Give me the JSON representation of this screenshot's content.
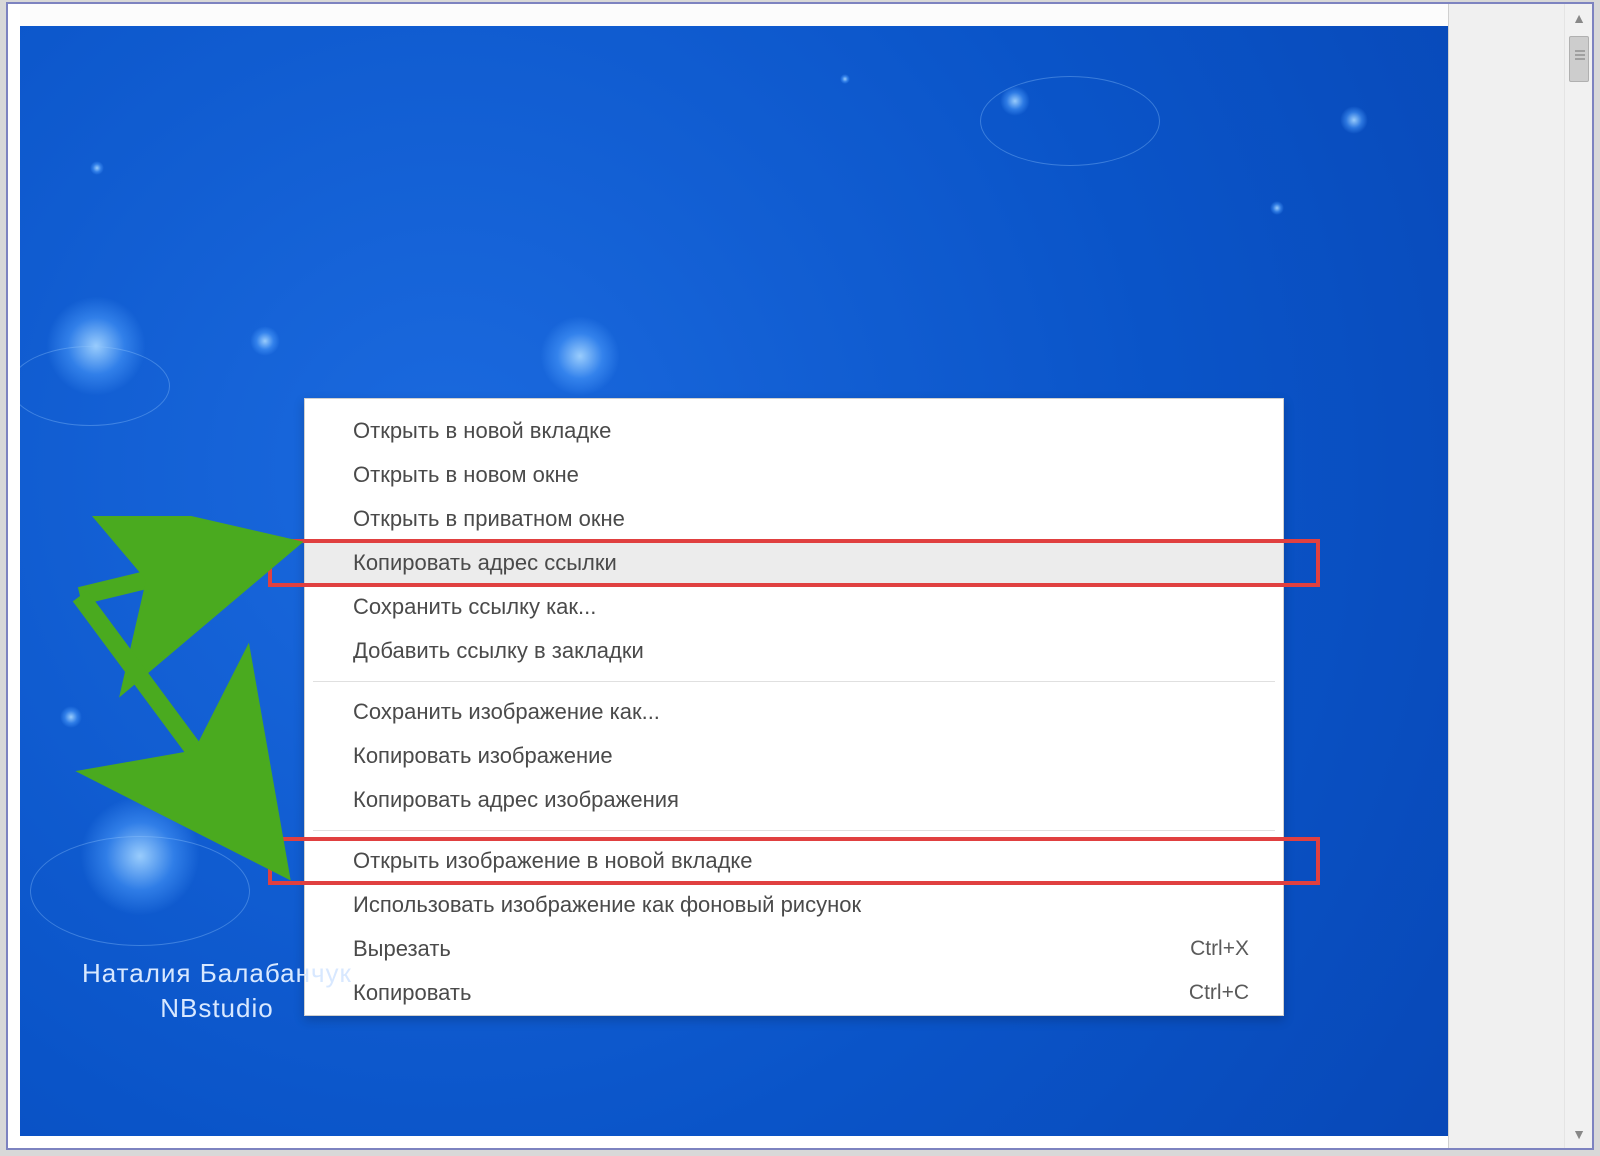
{
  "context_menu": {
    "items": [
      {
        "label": "Открыть в новой вкладке",
        "shortcut": "",
        "hover": false
      },
      {
        "label": "Открыть в новом окне",
        "shortcut": "",
        "hover": false
      },
      {
        "label": "Открыть в приватном окне",
        "shortcut": "",
        "hover": false
      },
      {
        "label": "Копировать адрес ссылки",
        "shortcut": "",
        "hover": true
      },
      {
        "label": "Сохранить ссылку как...",
        "shortcut": "",
        "hover": false
      },
      {
        "label": "Добавить ссылку в закладки",
        "shortcut": "",
        "hover": false
      },
      {
        "sep": true
      },
      {
        "label": "Сохранить изображение как...",
        "shortcut": "",
        "hover": false
      },
      {
        "label": "Копировать изображение",
        "shortcut": "",
        "hover": false
      },
      {
        "label": "Копировать адрес изображения",
        "shortcut": "",
        "hover": false
      },
      {
        "sep": true
      },
      {
        "label": "Открыть изображение в новой вкладке",
        "shortcut": "",
        "hover": false
      },
      {
        "label": "Использовать изображение как фоновый рисунок",
        "shortcut": "",
        "hover": false
      },
      {
        "label": "Вырезать",
        "shortcut": "Ctrl+X",
        "hover": false
      },
      {
        "label": "Копировать",
        "shortcut": "Ctrl+C",
        "hover": false
      }
    ]
  },
  "watermark": {
    "line1": "Наталия Балабанчук",
    "line2": "NBstudio"
  },
  "highlights": {
    "box1": {
      "item_index": 3
    },
    "box2": {
      "item_index": 11
    }
  }
}
